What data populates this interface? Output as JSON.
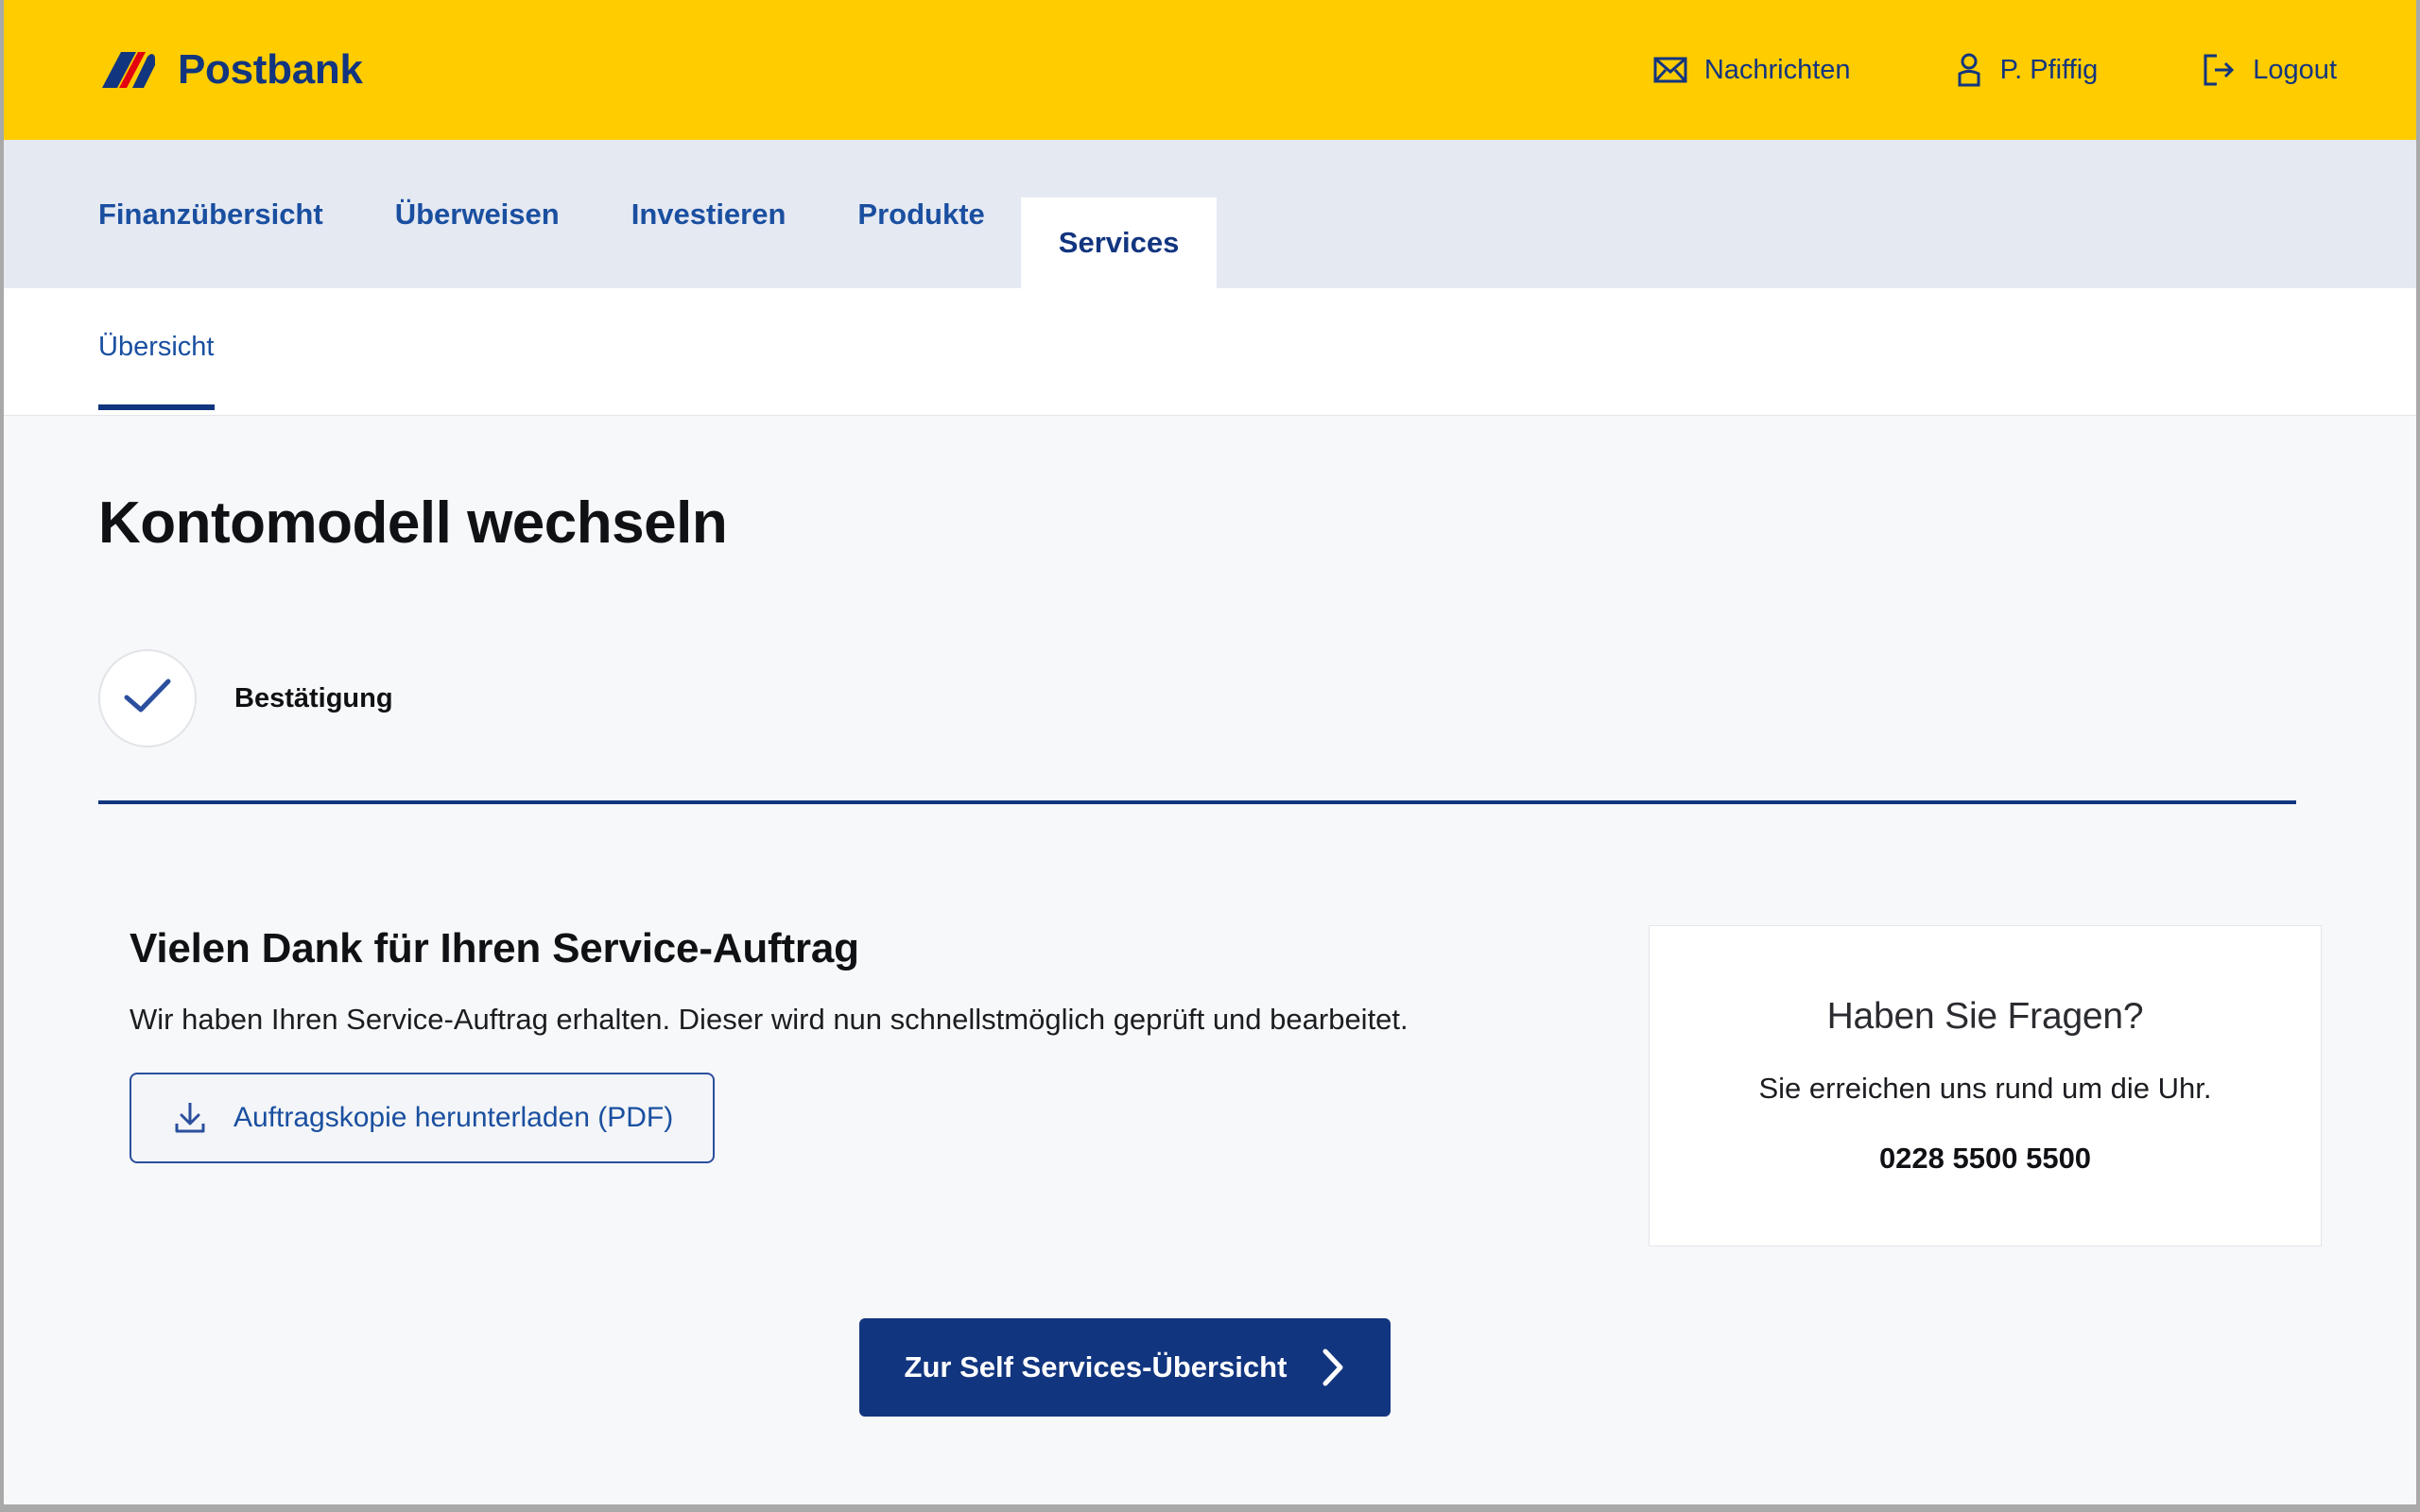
{
  "brand": {
    "name": "Postbank",
    "logo_icon": "postbank-swoosh-logo",
    "yellow": "#FFCC00",
    "navy": "#12357F",
    "red": "#E3000F"
  },
  "header": {
    "actions": [
      {
        "label": "Nachrichten",
        "icon": "envelope-icon"
      },
      {
        "label": "P. Pfiffig",
        "icon": "user-icon"
      },
      {
        "label": "Logout",
        "icon": "logout-icon"
      }
    ]
  },
  "nav": {
    "tabs": [
      {
        "label": "Finanzübersicht",
        "active": false
      },
      {
        "label": "Überweisen",
        "active": false
      },
      {
        "label": "Investieren",
        "active": false
      },
      {
        "label": "Produkte",
        "active": false
      },
      {
        "label": "Services",
        "active": true
      }
    ]
  },
  "subnav": {
    "items": [
      {
        "label": "Übersicht",
        "active": true
      }
    ]
  },
  "page": {
    "title": "Kontomodell wechseln"
  },
  "stepper": {
    "steps": [
      {
        "label": "Bestätigung",
        "icon": "check-icon",
        "state": "complete"
      }
    ]
  },
  "main": {
    "section_title": "Vielen Dank für Ihren Service-Auftrag",
    "section_body": "Wir haben Ihren Service-Auftrag erhalten. Dieser wird nun schnellstmöglich geprüft und bearbeitet.",
    "download_button": {
      "label": "Auftragskopie herunterladen (PDF)",
      "icon": "download-icon"
    }
  },
  "help_card": {
    "title": "Haben Sie Fragen?",
    "subtitle": "Sie erreichen uns rund um die Uhr.",
    "phone": "0228 5500 5500"
  },
  "cta": {
    "label": "Zur Self Services-Übersicht",
    "icon": "chevron-right-icon"
  }
}
